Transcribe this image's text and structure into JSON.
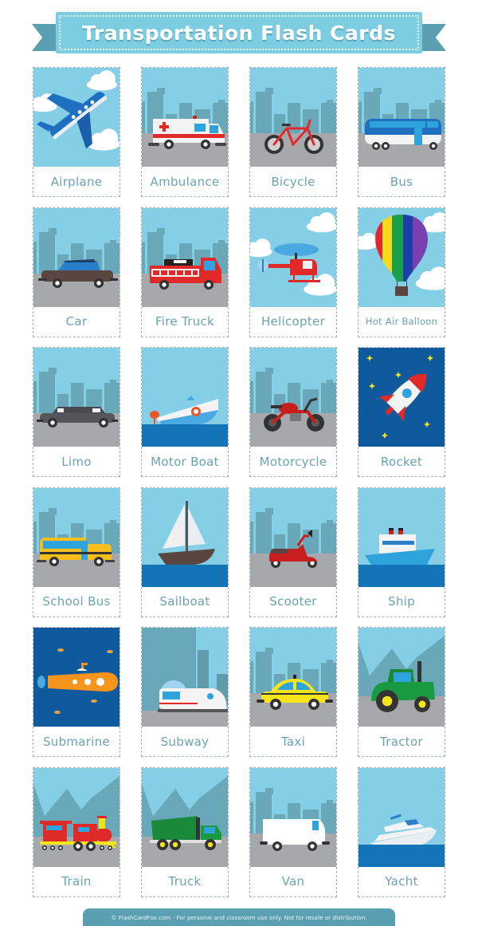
{
  "header": {
    "title": "Transportation Flash Cards"
  },
  "cards": [
    {
      "label": "Airplane",
      "scene": "sky",
      "icon": "airplane-icon"
    },
    {
      "label": "Ambulance",
      "scene": "city",
      "icon": "ambulance-icon"
    },
    {
      "label": "Bicycle",
      "scene": "city",
      "icon": "bicycle-icon"
    },
    {
      "label": "Bus",
      "scene": "city",
      "icon": "bus-icon"
    },
    {
      "label": "Car",
      "scene": "city",
      "icon": "car-icon"
    },
    {
      "label": "Fire Truck",
      "scene": "city",
      "icon": "fire-truck-icon"
    },
    {
      "label": "Helicopter",
      "scene": "sky",
      "icon": "helicopter-icon"
    },
    {
      "label": "Hot Air Balloon",
      "scene": "sky",
      "icon": "hot-air-balloon-icon"
    },
    {
      "label": "Limo",
      "scene": "city",
      "icon": "limo-icon"
    },
    {
      "label": "Motor Boat",
      "scene": "sea",
      "icon": "motor-boat-icon"
    },
    {
      "label": "Motorcycle",
      "scene": "city",
      "icon": "motorcycle-icon"
    },
    {
      "label": "Rocket",
      "scene": "space",
      "icon": "rocket-icon"
    },
    {
      "label": "School Bus",
      "scene": "city",
      "icon": "school-bus-icon"
    },
    {
      "label": "Sailboat",
      "scene": "sea",
      "icon": "sailboat-icon"
    },
    {
      "label": "Scooter",
      "scene": "city",
      "icon": "scooter-icon"
    },
    {
      "label": "Ship",
      "scene": "sea",
      "icon": "ship-icon"
    },
    {
      "label": "Submarine",
      "scene": "underwater",
      "icon": "submarine-icon"
    },
    {
      "label": "Subway",
      "scene": "tunnel",
      "icon": "subway-icon"
    },
    {
      "label": "Taxi",
      "scene": "city",
      "icon": "taxi-icon"
    },
    {
      "label": "Tractor",
      "scene": "mountains",
      "icon": "tractor-icon"
    },
    {
      "label": "Train",
      "scene": "mountains",
      "icon": "train-icon"
    },
    {
      "label": "Truck",
      "scene": "mountains",
      "icon": "truck-icon"
    },
    {
      "label": "Van",
      "scene": "city",
      "icon": "van-icon"
    },
    {
      "label": "Yacht",
      "scene": "sea",
      "icon": "yacht-icon"
    }
  ],
  "footer": {
    "text": "© FlashCardFox.com - For personal and classroom use only. Not for resale or distribution."
  },
  "colors": {
    "banner": "#7ccce2",
    "banner_dark": "#5b9fb3",
    "sky": "#84cfe5",
    "buildings": "#68a8b9",
    "road": "#a6a8ab",
    "sea": "#1474b8",
    "space": "#0f5a9c",
    "label_text": "#6aa3b2"
  }
}
